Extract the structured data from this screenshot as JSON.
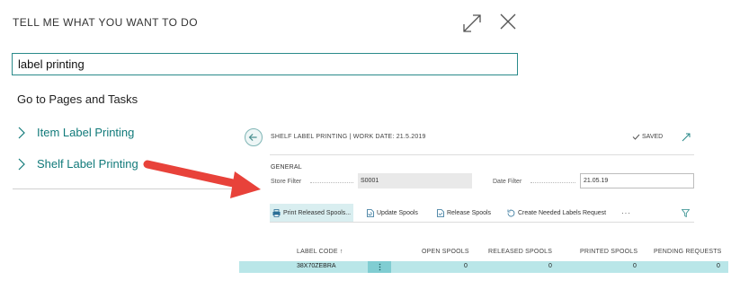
{
  "tell_me": {
    "title": "TELL ME WHAT YOU WANT TO DO",
    "search_value": "label printing",
    "section_heading": "Go to Pages and Tasks",
    "results": [
      "Item Label Printing",
      "Shelf Label Printing"
    ]
  },
  "page": {
    "title": "SHELF LABEL PRINTING | WORK DATE: 21.5.2019",
    "saved_status": "SAVED",
    "group": "GENERAL",
    "store_filter_label": "Store Filter",
    "store_filter_value": "S0001",
    "date_filter_label": "Date Filter",
    "date_filter_value": "21.05.19",
    "actions": [
      "Print Released Spools...",
      "Update Spools",
      "Release Spools",
      "Create Needed Labels Request"
    ],
    "more": "···",
    "columns": [
      "LABEL CODE ↑",
      "OPEN SPOOLS",
      "RELEASED SPOOLS",
      "PRINTED SPOOLS",
      "PENDING REQUESTS"
    ],
    "rows": [
      {
        "label_code": "38X70ZEBRA",
        "open": "0",
        "released": "0",
        "printed": "0",
        "pending": "0"
      }
    ]
  },
  "colors": {
    "accent": "#117a7a",
    "row_highlight": "#b9e6e8",
    "arrow": "#e8423a"
  }
}
